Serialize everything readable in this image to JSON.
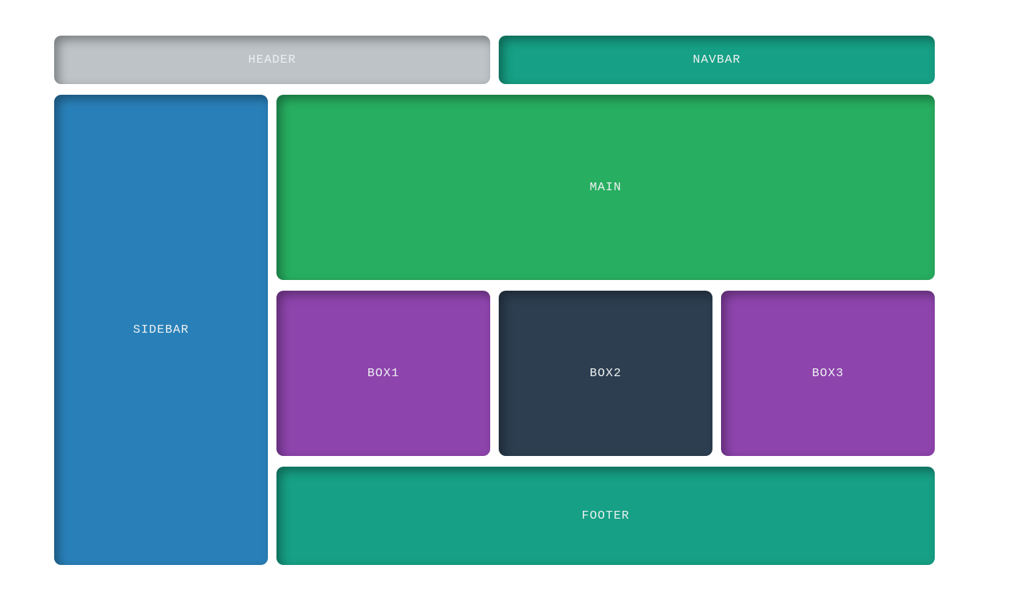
{
  "layout": {
    "header": {
      "label": "HEADER",
      "color": "#bdc3c7"
    },
    "navbar": {
      "label": "NAVBAR",
      "color": "#16a085"
    },
    "sidebar": {
      "label": "SIDEBAR",
      "color": "#2980b9"
    },
    "main": {
      "label": "MAIN",
      "color": "#27ae60"
    },
    "box1": {
      "label": "BOX1",
      "color": "#8e44ad"
    },
    "box2": {
      "label": "BOX2",
      "color": "#2c3e50"
    },
    "box3": {
      "label": "BOX3",
      "color": "#8e44ad"
    },
    "footer": {
      "label": "FOOTER",
      "color": "#16a085"
    }
  },
  "text_color": "#ecf0f1"
}
